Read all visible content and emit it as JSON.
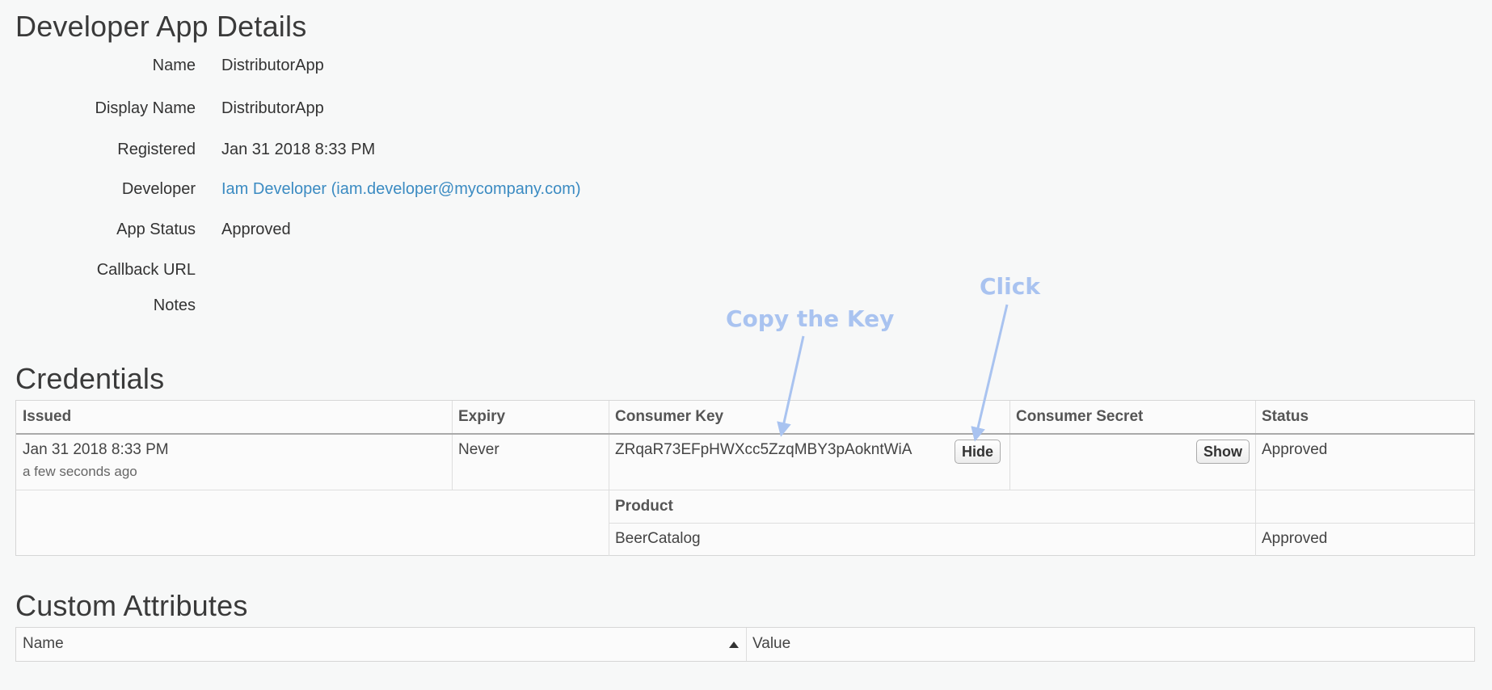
{
  "details": {
    "title": "Developer App Details",
    "rows": [
      {
        "label": "Name",
        "value": "DistributorApp"
      },
      {
        "label": "Display Name",
        "value": "DistributorApp"
      },
      {
        "label": "Registered",
        "value": "Jan 31 2018 8:33 PM"
      },
      {
        "label": "Developer",
        "value": "Iam Developer (iam.developer@mycompany.com)"
      },
      {
        "label": "App Status",
        "value": "Approved"
      },
      {
        "label": "Callback URL",
        "value": ""
      },
      {
        "label": "Notes",
        "value": ""
      }
    ]
  },
  "credentials": {
    "title": "Credentials",
    "headers": {
      "issued": "Issued",
      "expiry": "Expiry",
      "consumer_key": "Consumer Key",
      "consumer_secret": "Consumer Secret",
      "status": "Status"
    },
    "row": {
      "issued": "Jan 31 2018 8:33 PM",
      "issued_relative": "a few seconds ago",
      "expiry": "Never",
      "consumer_key": "ZRqaR73EFpHWXcc5ZzqMBY3pAokntWiA",
      "hide_label": "Hide",
      "show_label": "Show",
      "status": "Approved"
    },
    "product_header": "Product",
    "product": {
      "name": "BeerCatalog",
      "status": "Approved"
    }
  },
  "custom_attributes": {
    "title": "Custom Attributes",
    "headers": {
      "name": "Name",
      "value": "Value"
    }
  },
  "annotations": {
    "copy_key": "Copy the Key",
    "click": "Click"
  },
  "colors": {
    "link": "#3b8bc2",
    "annotation": "#a9c3f0"
  },
  "icons": {
    "sort": "sort-ascending-icon",
    "arrow": "arrow-icon"
  }
}
